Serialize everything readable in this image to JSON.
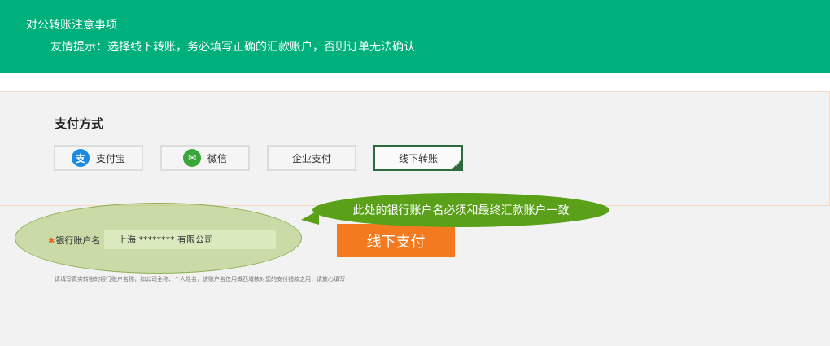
{
  "banner": {
    "title": "对公转账注意事项",
    "tip": "友情提示：选择线下转账，务必填写正确的汇款账户，否则订单无法确认"
  },
  "payment": {
    "title": "支付方式",
    "methods": [
      {
        "label": "支付宝",
        "icon": "alipay-icon",
        "glyph": "支",
        "color": "#1a8be0"
      },
      {
        "label": "微信",
        "icon": "wechat-icon",
        "glyph": "✉",
        "color": "#3aa53a"
      },
      {
        "label": "企业支付"
      },
      {
        "label": "线下转账",
        "selected": true
      }
    ]
  },
  "bank": {
    "label": "银行账户名",
    "value": "上海 ******** 有限公司"
  },
  "callout": "此处的银行账户名必须和最终汇款账户一致",
  "submit_label": "线下支付",
  "note": "请填写真实转账的银行账户名称，如公司全称、个人姓名，该账户名仅用做西域核对您的支付钱款之用，请放心填写",
  "colors": {
    "banner": "#00b07c",
    "accent": "#f47a20",
    "selected_border": "#2d6b3f",
    "callout": "#5aa019"
  }
}
